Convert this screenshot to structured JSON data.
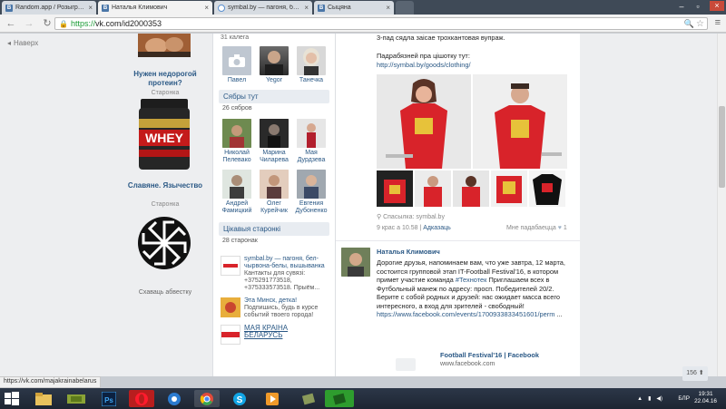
{
  "browser": {
    "tabs": [
      {
        "label": "Random.app / Розыгры...",
        "favicon": "vk"
      },
      {
        "label": "Наталья Климович",
        "favicon": "vk"
      },
      {
        "label": "symbal.by — пагоня, бел...",
        "favicon": "sb"
      },
      {
        "label": "Сыцяна",
        "favicon": "vk"
      }
    ],
    "url_scheme": "https://",
    "url_rest": "vk.com/id2000353"
  },
  "page": {
    "back_label": "Наверх",
    "ads": [
      {
        "title": "Нужен недорогой протеин?",
        "sub": "Старонка"
      },
      {
        "title": "Славяне. Язычество",
        "sub": "Старонка"
      }
    ],
    "hide_ads": "Схаваць абвестку",
    "profile": {
      "friends_count": "31 калега",
      "friends": [
        {
          "name": "Павел"
        },
        {
          "name": "Yegor"
        },
        {
          "name": "Танечка"
        }
      ],
      "online_title": "Сябры тут",
      "online_count": "26 сябров",
      "online_friends": [
        {
          "name": "Николай Пелевако"
        },
        {
          "name": "Марина Чиларева"
        },
        {
          "name": "Мая Дурдзева"
        },
        {
          "name": "Андрей Фамицкий"
        },
        {
          "name": "Олег Курейчик"
        },
        {
          "name": "Евгения Дубоненко"
        }
      ],
      "pages_title": "Цікавыя старонкі",
      "pages_count": "28 старонак",
      "pages": [
        {
          "title": "symbal.by — пагоня, бел-чырвона-белы, вышыванка",
          "text": "Кантакты для сувязі: +375291773518, +375333573518. Прыём..."
        },
        {
          "title": "Эта Минск, детка!",
          "text": "Подпишись, будь в курсе событий твоего города!"
        },
        {
          "title": "МАЯ КРАІНА БЕЛАРУСЬ",
          "text": ""
        }
      ]
    },
    "wall": {
      "post1_line": "3-пад сядла заісае трохкантовая вупраж.",
      "more_label": "Падрабязней пра цішотку тут:",
      "more_link": "http://symbal.by/goods/clothing/",
      "source_label": "Спасылка: symbal.by",
      "date": "9 крас а 10.58",
      "reply": "Адказаць",
      "likes": "Мне падабаецца",
      "likes_count": "1",
      "author": "Наталья Климович",
      "post2_text": "Дорогие друзья, напоминаем вам, что уже завтра, 12 марта, состоится групповой этап IT-Football Festival'16, в котором примет участие команда ",
      "post2_hashtag": "#Технотек",
      "post2_text2": "Приглашаем всех в Футбольный манеж по адресу: просп. Победителей 20/2. Берите с собой родных и друзей: нас ожидает масса всего интересного, а вход для зрителей - свободный!",
      "post2_link": "https://www.facebook.com/events/1700933833451601/perm",
      "post2_dots": "...",
      "card_title": "Football Festival'16 | Facebook",
      "card_url": "www.facebook.com"
    },
    "pager_badge": "156"
  },
  "status_url": "https://vk.com/majakrainabelarus",
  "taskbar": {
    "lang": "БЛР",
    "time": "19:31",
    "date": "22.04.16"
  },
  "colors": {
    "vk_blue": "#2a5885",
    "vk_header": "#4a76a8",
    "tabbar": "#3f4a57",
    "shirt_red": "#d8232a"
  }
}
